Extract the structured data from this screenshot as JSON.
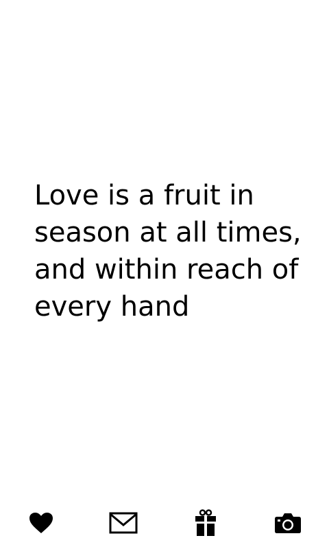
{
  "quote": {
    "text": "Love is a fruit in\nseason at all times,\nand within reach of\nevery hand"
  },
  "toolbar": {
    "items": [
      {
        "icon": "heart-icon"
      },
      {
        "icon": "mail-icon"
      },
      {
        "icon": "gift-icon"
      },
      {
        "icon": "camera-icon"
      }
    ]
  },
  "colors": {
    "background": "#ffffff",
    "foreground": "#000000"
  }
}
